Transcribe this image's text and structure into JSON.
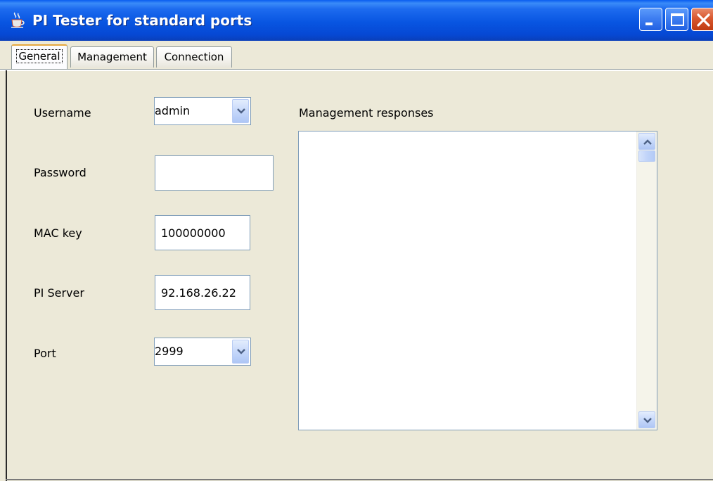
{
  "window": {
    "title": "PI Tester for standard ports"
  },
  "tabs": [
    {
      "label": "General",
      "active": true
    },
    {
      "label": "Management",
      "active": false
    },
    {
      "label": "Connection",
      "active": false
    }
  ],
  "form": {
    "username_label": "Username",
    "username_value": "admin",
    "password_label": "Password",
    "password_value": "",
    "mac_key_label": "MAC key",
    "mac_key_value": "100000000",
    "pi_server_label": "PI Server",
    "pi_server_value": "92.168.26.22",
    "port_label": "Port",
    "port_value": "2999"
  },
  "responses": {
    "label": "Management responses",
    "content": ""
  },
  "icons": {
    "app": "java-coffee-cup-icon",
    "minimize": "minimize-icon",
    "maximize": "maximize-icon",
    "close": "close-icon",
    "dropdown": "chevron-down-icon",
    "scroll_up": "arrow-up-icon",
    "scroll_down": "arrow-down-icon"
  },
  "colors": {
    "titlebar": "#0855E1",
    "window_background": "#ECE9D8",
    "field_border": "#7F9DB9",
    "close_button": "#D9582F",
    "active_tab_highlight": "#E6A83E"
  }
}
